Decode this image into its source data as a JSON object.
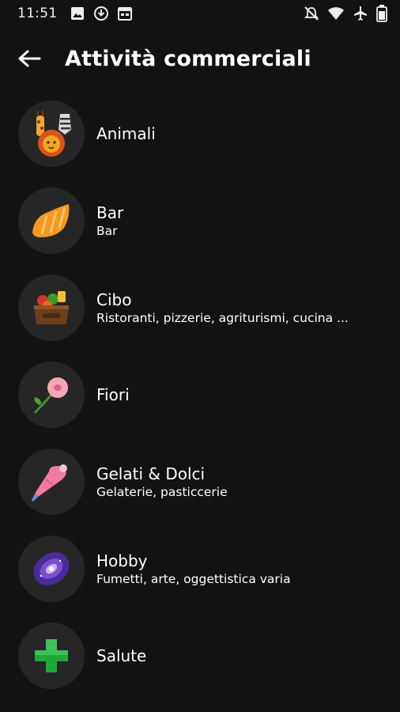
{
  "status_bar": {
    "time": "11:51",
    "left_icons": [
      "image-icon",
      "download-icon",
      "calendar-icon"
    ],
    "right_icons": [
      "notifications-off-icon",
      "wifi-icon",
      "airplane-icon",
      "battery-icon"
    ]
  },
  "app_bar": {
    "title": "Attività commerciali",
    "back_icon": "arrow-left-icon"
  },
  "categories": [
    {
      "title": "Animali",
      "subtitle": "",
      "icon": "animals-icon"
    },
    {
      "title": "Bar",
      "subtitle": "Bar",
      "icon": "croissant-icon"
    },
    {
      "title": "Cibo",
      "subtitle": "Ristoranti, pizzerie, agriturismi, cucina ...",
      "icon": "food-basket-icon"
    },
    {
      "title": "Fiori",
      "subtitle": "",
      "icon": "rose-icon"
    },
    {
      "title": "Gelati & Dolci",
      "subtitle": "Gelaterie, pasticcerie",
      "icon": "piping-bag-icon"
    },
    {
      "title": "Hobby",
      "subtitle": "Fumetti, arte, oggettistica varia",
      "icon": "galaxy-icon"
    },
    {
      "title": "Salute",
      "subtitle": "",
      "icon": "green-cross-icon"
    }
  ]
}
